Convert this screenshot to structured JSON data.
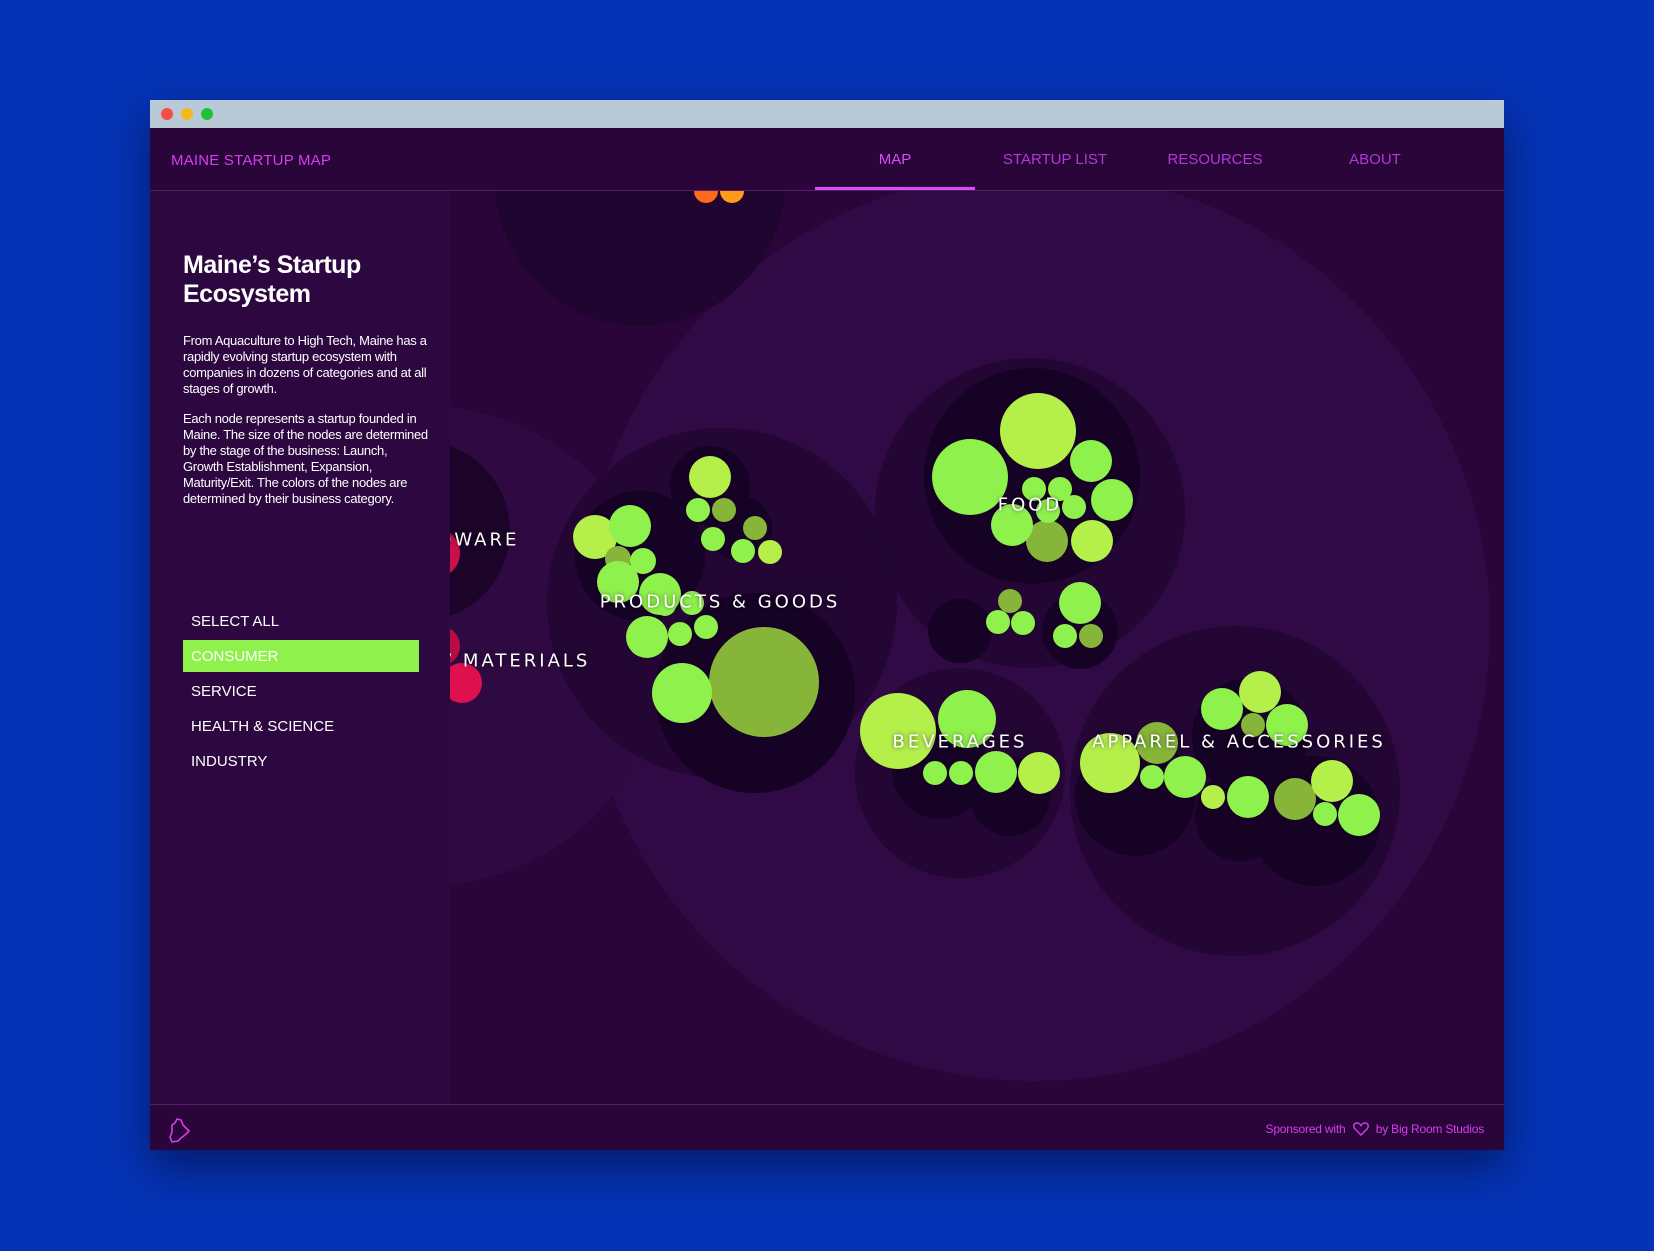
{
  "app": {
    "brand": "MAINE STARTUP MAP"
  },
  "nav": {
    "items": [
      {
        "label": "MAP",
        "active": true
      },
      {
        "label": "STARTUP LIST",
        "active": false
      },
      {
        "label": "RESOURCES",
        "active": false
      },
      {
        "label": "ABOUT",
        "active": false
      }
    ]
  },
  "sidebar": {
    "title": "Maine’s Startup Ecosystem",
    "paragraph1": "From Aquaculture to High Tech, Maine has a rapidly evolving startup ecosystem with companies in dozens of categories and at all stages of growth.",
    "paragraph2": "Each node represents a startup founded in Maine. The size of the nodes are determined by the stage of the business: Launch, Growth Establishment, Expansion, Maturity/Exit. The colors of the nodes are determined by their business category.",
    "filters": [
      {
        "label": "SELECT ALL",
        "active": false
      },
      {
        "label": "CONSUMER",
        "active": true
      },
      {
        "label": "SERVICE",
        "active": false
      },
      {
        "label": "HEALTH & SCIENCE",
        "active": false
      },
      {
        "label": "INDUSTRY",
        "active": false
      }
    ]
  },
  "map": {
    "clusters": [
      {
        "label": "RDWARE"
      },
      {
        "label": "S / MATERIALS"
      },
      {
        "label": "PRODUCTS & GOODS"
      },
      {
        "label": "FOOD"
      },
      {
        "label": "BEVERAGES"
      },
      {
        "label": "APPAREL & ACCESSORIES"
      }
    ],
    "colors": {
      "consumer_light": "#8ff24c",
      "consumer_lime": "#b4ef4a",
      "consumer_olive": "#87b53a",
      "industry": "#e0104f",
      "service": "#ff6a1a"
    }
  },
  "footer": {
    "sponsor_prefix": "Sponsored with",
    "sponsor_suffix": "by Big Room Studios",
    "logo": "maine-state-icon",
    "heart": "heart-icon"
  }
}
